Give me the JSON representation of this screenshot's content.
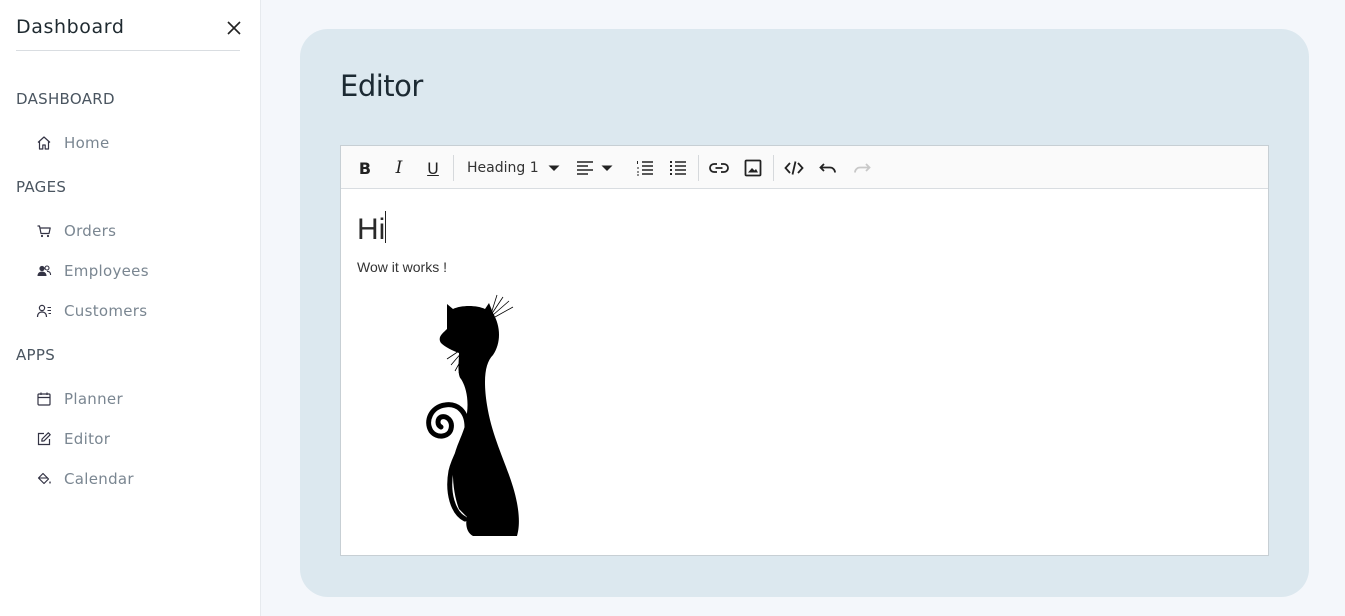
{
  "sidebar": {
    "title": "Dashboard",
    "sections": [
      {
        "label": "DASHBOARD",
        "items": [
          {
            "label": "Home",
            "icon": "home-icon"
          }
        ]
      },
      {
        "label": "PAGES",
        "items": [
          {
            "label": "Orders",
            "icon": "cart-icon"
          },
          {
            "label": "Employees",
            "icon": "employees-icon"
          },
          {
            "label": "Customers",
            "icon": "customers-icon"
          }
        ]
      },
      {
        "label": "APPS",
        "items": [
          {
            "label": "Planner",
            "icon": "calendar-icon"
          },
          {
            "label": "Editor",
            "icon": "edit-icon"
          },
          {
            "label": "Calendar",
            "icon": "paint-bucket-icon"
          }
        ]
      }
    ]
  },
  "main": {
    "title": "Editor"
  },
  "editor": {
    "toolbar": {
      "bold": "B",
      "italic": "I",
      "underline": "U",
      "heading_select": "Heading 1"
    },
    "content": {
      "heading": "Hi",
      "paragraph": "Wow it works !"
    }
  },
  "colors": {
    "sidebar_bg": "#ffffff",
    "page_bg": "#f4f7fb",
    "card_bg": "#dce8ef",
    "muted_text": "#7a8691"
  }
}
